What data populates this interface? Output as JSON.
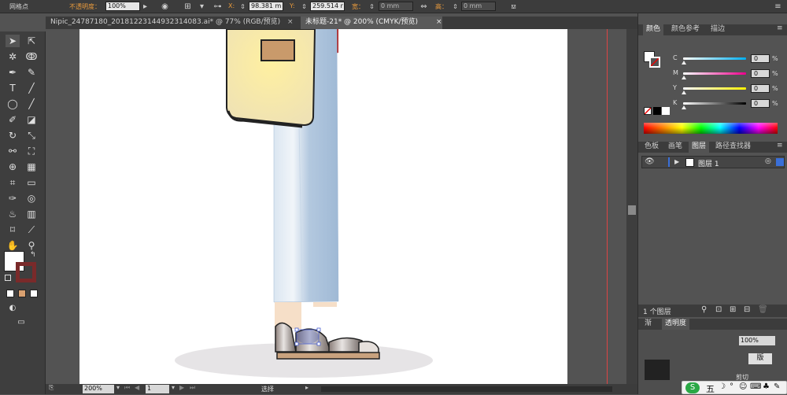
{
  "control_bar": {
    "mode_label": "网格点",
    "opacity_label": "不透明度：",
    "opacity_value": "100%",
    "x_label": "X:",
    "x_value": "98.381 m",
    "y_label": "Y:",
    "y_value": "259.514 r",
    "width_label": "宽：",
    "width_value": "0 mm",
    "height_label": "高：",
    "height_value": "0 mm"
  },
  "tabs": [
    {
      "label": "Nipic_24787180_20181223144932314083.ai* @ 77% (RGB/预览)",
      "active": false
    },
    {
      "label": "未标题-21* @ 200% (CMYK/预览)",
      "active": true
    }
  ],
  "tab_close_glyph": "×",
  "status_bar": {
    "zoom": "200%",
    "artboard_number": "1",
    "tool_status": "选择"
  },
  "color_panel": {
    "tabs": [
      "颜色",
      "颜色参考",
      "描边"
    ],
    "sliders": [
      {
        "label": "C",
        "value": "0",
        "unit": "%",
        "color": "#00aeef"
      },
      {
        "label": "M",
        "value": "0",
        "unit": "%",
        "color": "#ec008c"
      },
      {
        "label": "Y",
        "value": "0",
        "unit": "%",
        "color": "#fff200"
      },
      {
        "label": "K",
        "value": "0",
        "unit": "%",
        "color": "#000000"
      }
    ]
  },
  "layers_panel": {
    "tabs": [
      "色板",
      "画笔",
      "图层",
      "路径查找器"
    ],
    "layers": [
      {
        "name": "图层 1"
      }
    ],
    "footer_count": "1 个图层"
  },
  "bottom_panel": {
    "tabs": [
      "渐",
      "透明度"
    ],
    "opacity_value": "100%",
    "button_partial": "版",
    "clip_partial": "剪切"
  },
  "ime": {
    "label": "五"
  },
  "colors": {
    "accent_orange": "#e89a3c",
    "guide_red": "#dd4444",
    "bag_yellow": "#f6e39a",
    "jeans_blue": "#a8c1dc",
    "ground_shadow": "#e6e4e6"
  }
}
